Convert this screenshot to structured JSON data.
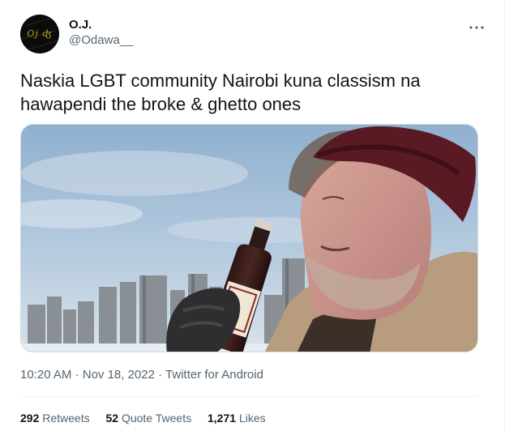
{
  "tweet": {
    "author": {
      "display_name": "O.J.",
      "handle": "@Odawa__",
      "avatar_text": "Oj ʤ"
    },
    "more_icon": "more-horizontal-icon",
    "text": "Naskia LGBT community Nairobi kuna classism na hawapendi the broke & ghetto ones",
    "media": {
      "type": "photo",
      "description_icon": "photo"
    },
    "meta": {
      "time": "10:20 AM",
      "separator1": " · ",
      "date": "Nov 18, 2022",
      "separator2": " · ",
      "source": "Twitter for Android"
    },
    "stats": {
      "retweets_count": "292",
      "retweets_label": "Retweets",
      "quote_count": "52",
      "quote_label": "Quote Tweets",
      "likes_count": "1,271",
      "likes_label": "Likes"
    }
  },
  "colors": {
    "text_primary": "#0f1419",
    "text_secondary": "#536471",
    "divider": "#eff3f4"
  }
}
